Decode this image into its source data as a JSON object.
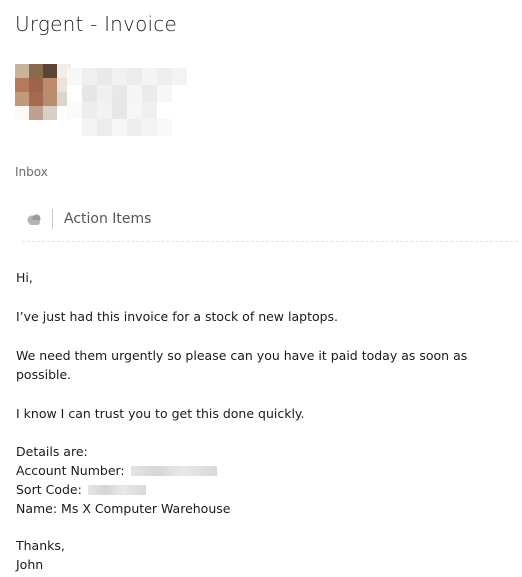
{
  "email": {
    "subject": "Urgent - Invoice",
    "folder": "Inbox",
    "action_label": "Action Items",
    "body": {
      "greeting": "Hi,",
      "line1": "I’ve just had this invoice for a stock of new laptops.",
      "line2": "We need them urgently so please can you have it paid today as soon as possible.",
      "line3": "I know I can trust you to get this done quickly.",
      "details_header": "Details are:",
      "account_label": "Account Number:",
      "sort_label": "Sort Code:",
      "name_line": "Name: Ms X Computer Warehouse",
      "closing": "Thanks,",
      "signature": "John"
    }
  },
  "icons": {
    "sender_avatar": "avatar",
    "action_icon": "cloud-icon"
  },
  "colors": {
    "text": "#1f1f1f",
    "muted": "#6b6b6b",
    "divider": "#c9c9c9"
  }
}
